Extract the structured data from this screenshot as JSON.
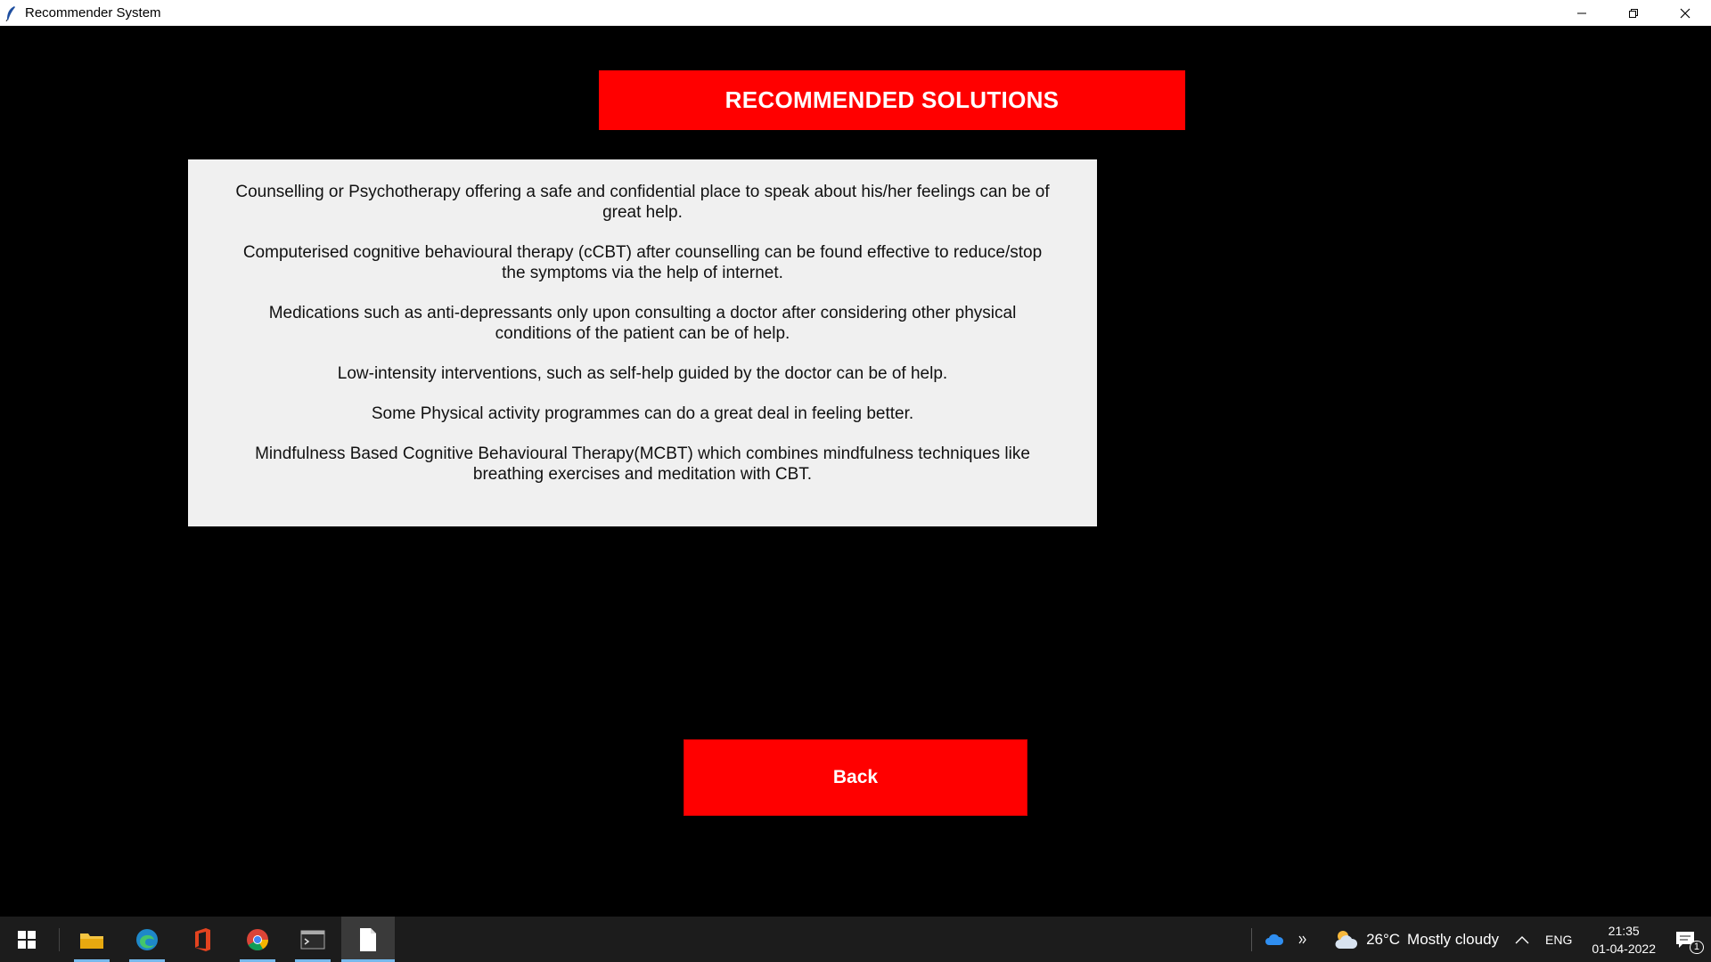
{
  "window": {
    "title": "Recommender System",
    "controls": {
      "minimize": "minimize-icon",
      "restore": "restore-icon",
      "close": "close-icon"
    }
  },
  "header": {
    "title": "RECOMMENDED SOLUTIONS"
  },
  "solutions": [
    "Counselling or Psychotherapy offering a safe and confidential place to speak about his/her feelings can be of great help.",
    "Computerised cognitive behavioural therapy (cCBT) after counselling can be found effective to reduce/stop the symptoms via the help of internet.",
    "Medications such as anti-depressants only upon consulting a doctor after considering other physical conditions of the patient can be of help.",
    "Low-intensity interventions, such as self-help guided by the doctor can be of help.",
    "Some Physical activity programmes can do a great deal in feeling better.",
    "Mindfulness Based Cognitive Behavioural Therapy(MCBT) which combines mindfulness techniques like breathing exercises and meditation with CBT."
  ],
  "actions": {
    "back_label": "Back"
  },
  "taskbar": {
    "apps": [
      "file-explorer-icon",
      "edge-icon",
      "office-icon",
      "chrome-icon",
      "terminal-icon",
      "document-icon"
    ],
    "weather": {
      "temperature": "26°C",
      "condition": "Mostly cloudy"
    },
    "language": "ENG",
    "time": "21:35",
    "date": "01-04-2022",
    "notification_count": "1"
  },
  "colors": {
    "accent": "#ff0000",
    "panel": "#f0f0f0",
    "background": "#000000"
  }
}
